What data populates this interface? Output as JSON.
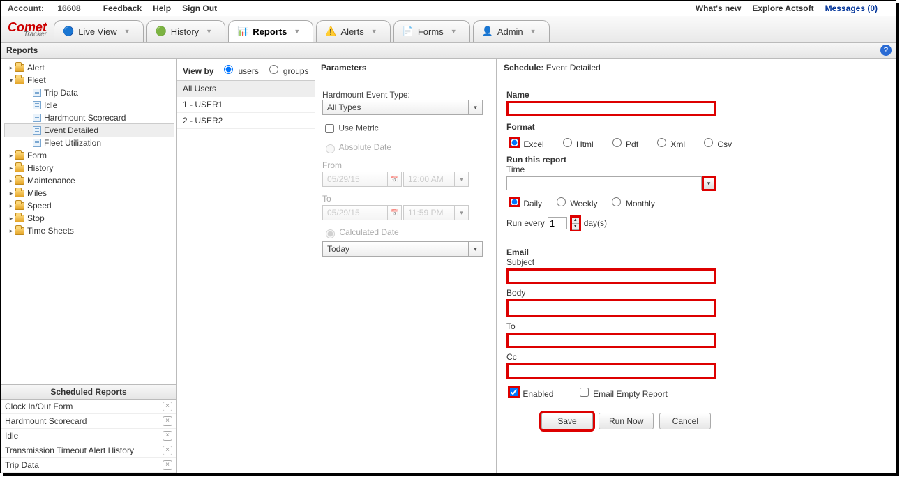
{
  "topbar": {
    "account_prefix": "Account: ",
    "account_id": "16608",
    "feedback": "Feedback",
    "help": "Help",
    "sign_out": "Sign Out",
    "whats_new": "What's new",
    "explore": "Explore Actsoft",
    "messages": "Messages (0)"
  },
  "logo": {
    "main": "Comet",
    "sub": "Tracker"
  },
  "tabs": [
    {
      "label": "Live View",
      "active": false
    },
    {
      "label": "History",
      "active": false
    },
    {
      "label": "Reports",
      "active": true
    },
    {
      "label": "Alerts",
      "active": false
    },
    {
      "label": "Forms",
      "active": false
    },
    {
      "label": "Admin",
      "active": false
    }
  ],
  "section_title": "Reports",
  "tree": [
    {
      "type": "folder",
      "label": "Alert",
      "expand": "▸",
      "indent": 0
    },
    {
      "type": "folder",
      "label": "Fleet",
      "expand": "▾",
      "indent": 0
    },
    {
      "type": "file",
      "label": "Trip Data",
      "indent": 2
    },
    {
      "type": "file",
      "label": "Idle",
      "indent": 2
    },
    {
      "type": "file",
      "label": "Hardmount Scorecard",
      "indent": 2
    },
    {
      "type": "file",
      "label": "Event Detailed",
      "indent": 2,
      "selected": true
    },
    {
      "type": "file",
      "label": "Fleet Utilization",
      "indent": 2
    },
    {
      "type": "folder",
      "label": "Form",
      "expand": "▸",
      "indent": 0
    },
    {
      "type": "folder",
      "label": "History",
      "expand": "▸",
      "indent": 0
    },
    {
      "type": "folder",
      "label": "Maintenance",
      "expand": "▸",
      "indent": 0
    },
    {
      "type": "folder",
      "label": "Miles",
      "expand": "▸",
      "indent": 0
    },
    {
      "type": "folder",
      "label": "Speed",
      "expand": "▸",
      "indent": 0
    },
    {
      "type": "folder",
      "label": "Stop",
      "expand": "▸",
      "indent": 0
    },
    {
      "type": "folder",
      "label": "Time Sheets",
      "expand": "▸",
      "indent": 0
    }
  ],
  "scheduled": {
    "title": "Scheduled Reports",
    "items": [
      "Clock In/Out Form",
      "Hardmount Scorecard",
      "Idle",
      "Transmission Timeout Alert History",
      "Trip Data"
    ]
  },
  "viewby": {
    "title": "View by",
    "users": "users",
    "groups": "groups"
  },
  "userlist": [
    "All Users",
    "1 - USER1",
    "2 - USER2"
  ],
  "parameters": {
    "title": "Parameters",
    "event_type_label": "Hardmount Event Type:",
    "event_type_value": "All Types",
    "use_metric": "Use Metric",
    "absolute_date": "Absolute Date",
    "from": "From",
    "to": "To",
    "from_date": "05/29/15",
    "from_time": "12:00 AM",
    "to_date": "05/29/15",
    "to_time": "11:59 PM",
    "calculated_date": "Calculated Date",
    "calculated_value": "Today"
  },
  "schedule": {
    "title_prefix": "Schedule",
    "title_value": "Event Detailed",
    "name_label": "Name",
    "format_label": "Format",
    "formats": [
      "Excel",
      "Html",
      "Pdf",
      "Xml",
      "Csv"
    ],
    "run_label": "Run this report",
    "time_label": "Time",
    "freq": [
      "Daily",
      "Weekly",
      "Monthly"
    ],
    "run_every_label": "Run every",
    "run_every_value": "1",
    "run_every_unit": "day(s)",
    "email_label": "Email",
    "subject_label": "Subject",
    "body_label": "Body",
    "to_label": "To",
    "cc_label": "Cc",
    "enabled_label": "Enabled",
    "empty_label": "Email Empty Report",
    "save": "Save",
    "run_now": "Run Now",
    "cancel": "Cancel"
  }
}
